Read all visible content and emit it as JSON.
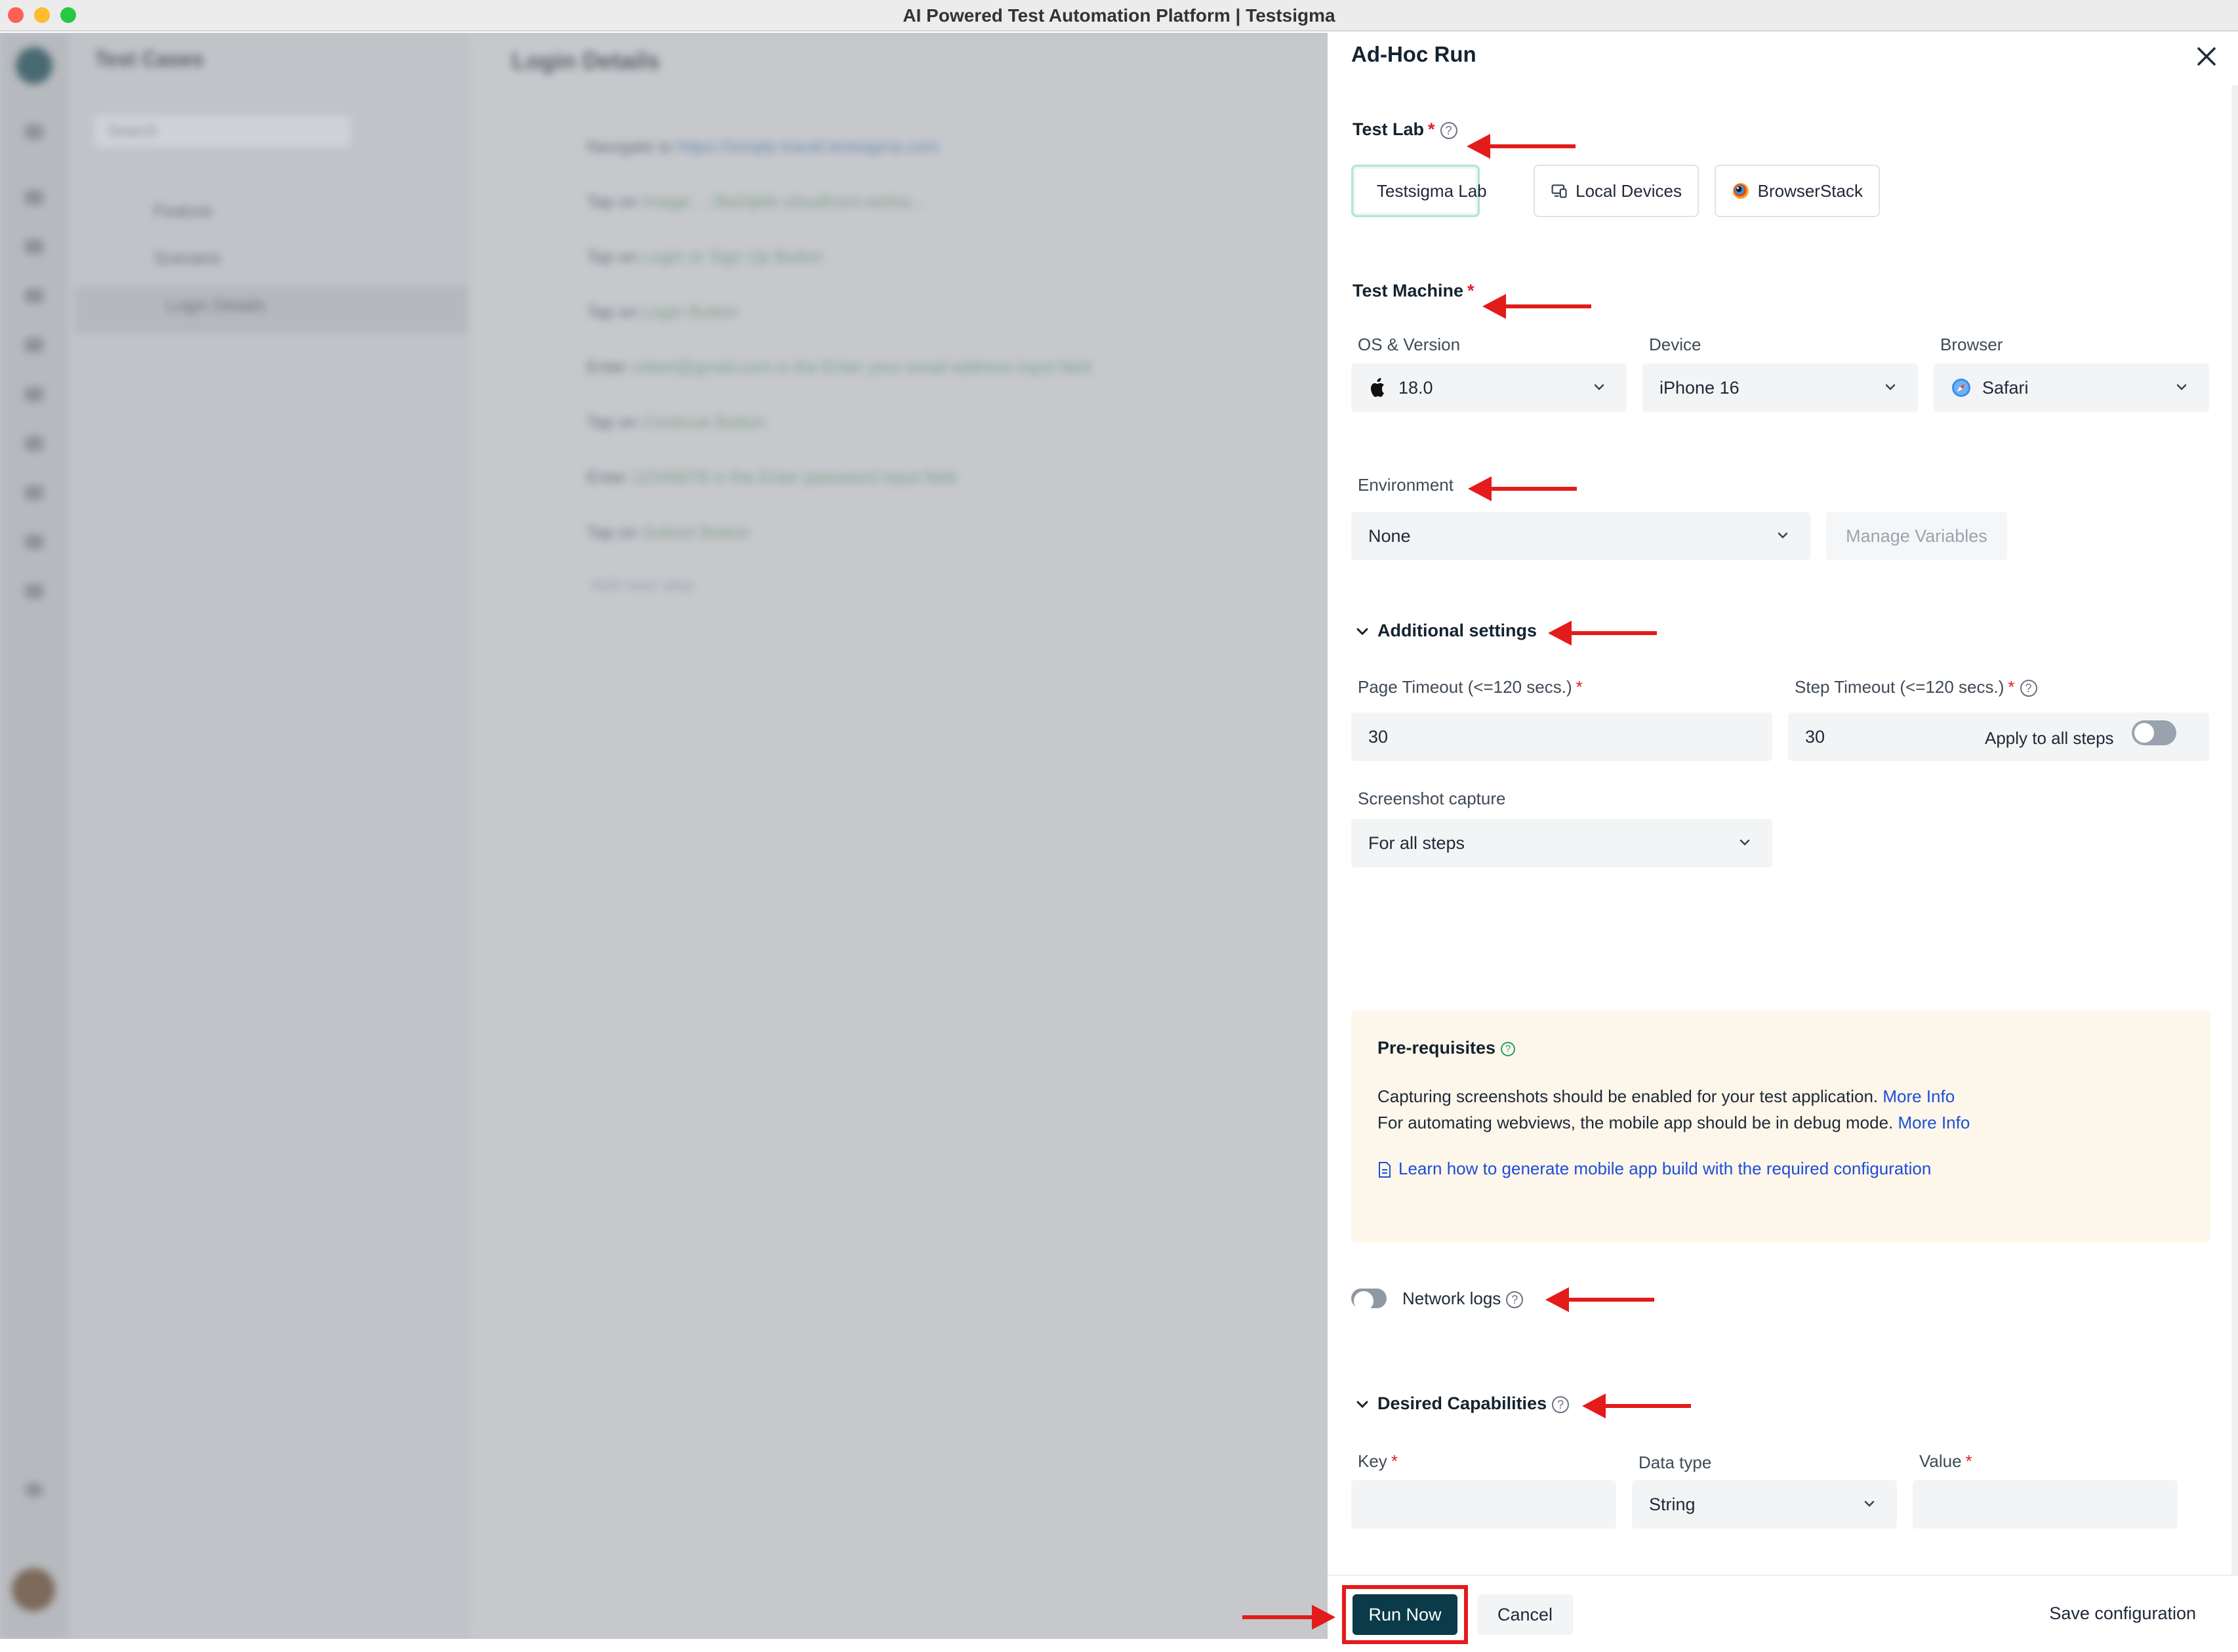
{
  "window": {
    "title": "AI Powered Test Automation Platform | Testsigma"
  },
  "background": {
    "panel_title": "Test Cases",
    "search_placeholder": "Search",
    "tree": [
      "Feature",
      "Scenario",
      "Login Details"
    ],
    "main_title": "Login Details",
    "steps": [
      [
        "Navigate to",
        "https://simply-travel.testsigma.com"
      ],
      [
        "Tap on",
        "Image: ...9ta2qkfe.cloudfront.net/ea..."
      ],
      [
        "Tap on",
        "Login or Sign Up Button"
      ],
      [
        "Tap on",
        "Login Button"
      ],
      [
        "Enter",
        "robert@gmail.com  in the  Enter your email address Input  field"
      ],
      [
        "Tap on",
        "Continue Button"
      ],
      [
        "Enter",
        "12345678  in the  Enter password Input  field"
      ],
      [
        "Tap on",
        "Submit Button"
      ]
    ],
    "add_step": "Add new step"
  },
  "drawer": {
    "title": "Ad-Hoc Run",
    "test_lab": {
      "label": "Test Lab",
      "required": "*",
      "options": [
        "Testsigma Lab",
        "Local Devices",
        "BrowserStack"
      ],
      "selected": "Testsigma Lab"
    },
    "test_machine": {
      "label": "Test Machine",
      "required": "*",
      "os_label": "OS & Version",
      "os_value": "18.0",
      "device_label": "Device",
      "device_value": "iPhone 16",
      "browser_label": "Browser",
      "browser_value": "Safari"
    },
    "environment": {
      "label": "Environment",
      "value": "None",
      "manage_button": "Manage Variables"
    },
    "additional_settings": {
      "label": "Additional settings",
      "page_timeout_label": "Page Timeout (<=120 secs.)",
      "page_timeout_value": "30",
      "step_timeout_label": "Step Timeout (<=120 secs.)",
      "step_timeout_value": "30",
      "apply_all_label": "Apply to all steps",
      "screenshot_label": "Screenshot capture",
      "screenshot_value": "For all steps"
    },
    "prerequisites": {
      "title": "Pre-requisites",
      "line1": "Capturing screenshots should be enabled for your test application.",
      "line2": "For automating webviews, the mobile app should be in debug mode.",
      "more_info": "More Info",
      "learn_link": "Learn how to generate mobile app build with the required configuration"
    },
    "network_logs": {
      "label": "Network logs"
    },
    "desired_capabilities": {
      "label": "Desired Capabilities",
      "key_label": "Key",
      "data_type_label": "Data type",
      "data_type_value": "String",
      "value_label": "Value",
      "required": "*"
    },
    "footer": {
      "run_now": "Run Now",
      "cancel": "Cancel",
      "save_configuration": "Save configuration"
    }
  },
  "colors": {
    "annotation_red": "#e41b1b",
    "primary_button": "#0b3a48",
    "link": "#1d4ed8",
    "required": "#e11d2e",
    "prereq_bg": "#fdf6ea"
  }
}
